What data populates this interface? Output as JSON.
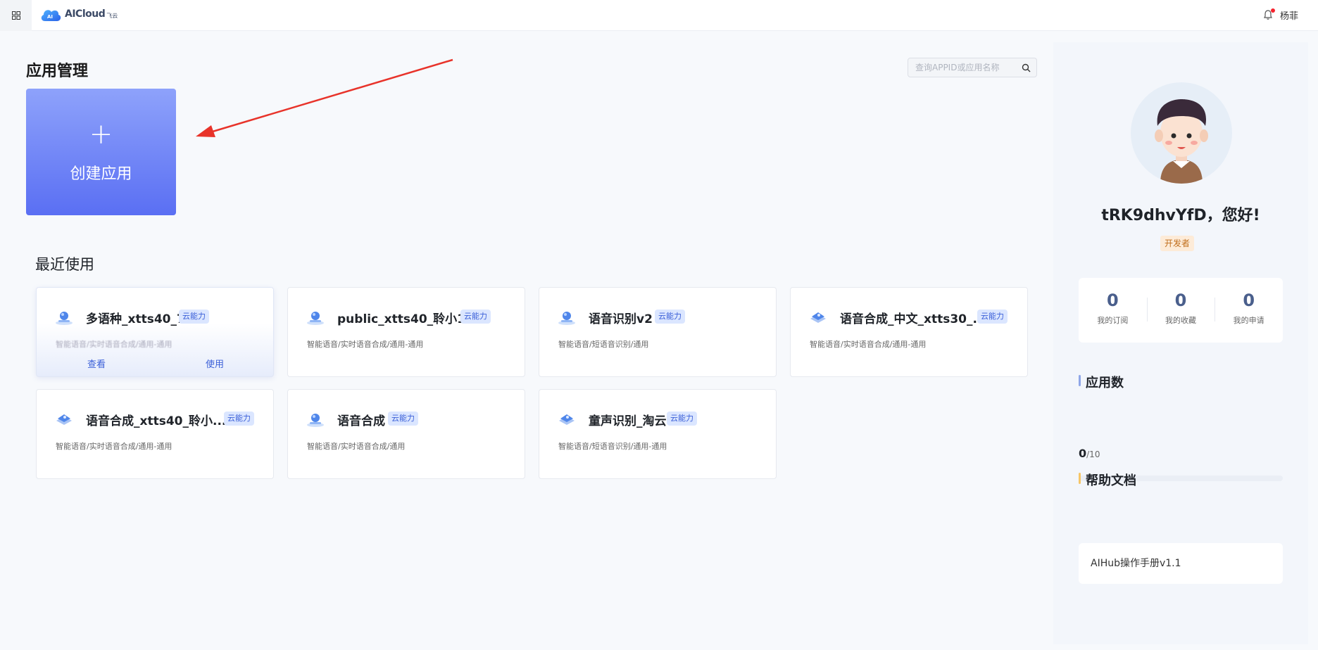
{
  "header": {
    "logo_text": "AICloud",
    "logo_sub": "飞云",
    "username": "杨菲"
  },
  "main": {
    "title": "应用管理",
    "search_placeholder": "查询APPID或应用名称",
    "create": {
      "plus": "+",
      "label": "创建应用"
    },
    "recent_title": "最近使用",
    "cards": [
      {
        "name": "多语种_xtts40_7",
        "badge": "云能力",
        "desc": "智能语音/实时语音合成/通用-通用",
        "icon": "speech-icon",
        "actions": {
          "view": "查看",
          "use": "使用"
        }
      },
      {
        "name": "public_xtts40_聆小18",
        "badge": "云能力",
        "desc": "智能语音/实时语音合成/通用-通用",
        "icon": "speech-icon"
      },
      {
        "name": "语音识别v2",
        "badge": "云能力",
        "desc": "智能语音/短语音识别/通用",
        "icon": "speech-icon"
      },
      {
        "name": "语音合成_中文_xtts30_...",
        "badge": "云能力",
        "desc": "智能语音/实时语音合成/通用-通用",
        "icon": "layer-icon"
      },
      {
        "name": "语音合成_xtts40_聆小...",
        "badge": "云能力",
        "desc": "智能语音/实时语音合成/通用-通用",
        "icon": "layer-icon"
      },
      {
        "name": "语音合成",
        "badge": "云能力",
        "desc": "智能语音/实时语音合成/通用",
        "icon": "speech-icon"
      },
      {
        "name": "童声识别_淘云",
        "badge": "云能力",
        "desc": "智能语音/短语音识别/通用-通用",
        "icon": "layer-icon"
      }
    ]
  },
  "sidebar": {
    "greeting": "tRK9dhvYfD，您好!",
    "role": "开发者",
    "stats": [
      {
        "value": "0",
        "label": "我的订阅"
      },
      {
        "value": "0",
        "label": "我的收藏"
      },
      {
        "value": "0",
        "label": "我的申请"
      }
    ],
    "apps_heading": "应用数",
    "app_count": {
      "used": "0",
      "total": "/10"
    },
    "docs_heading": "帮助文档",
    "doc_item": "AIHub操作手册v1.1"
  },
  "colors": {
    "accent": "#5a6ff3",
    "badge_bg": "#dbe6ff",
    "badge_text": "#3a5fd8",
    "arrow": "#e8332a"
  }
}
